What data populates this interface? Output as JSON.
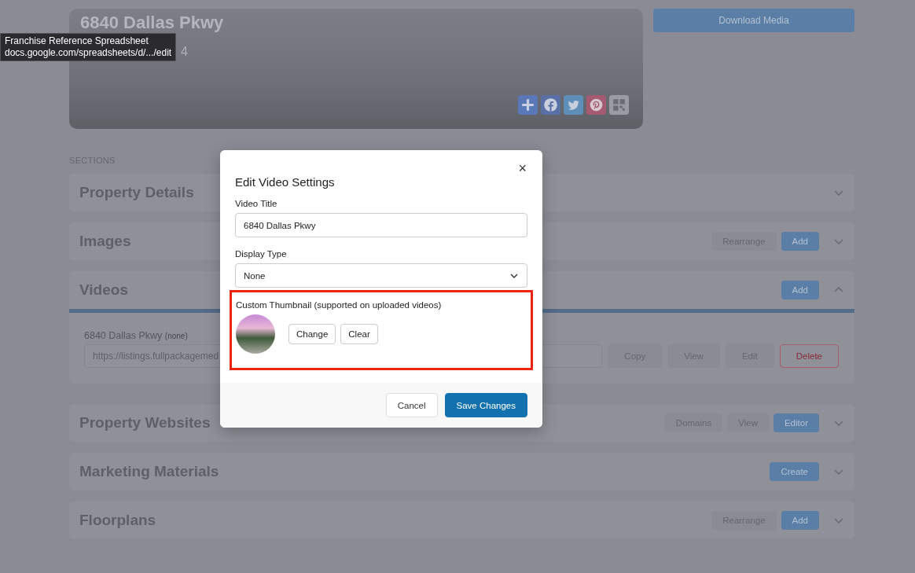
{
  "hero": {
    "title": "6840 Dallas Pkwy",
    "subtitle": "4",
    "share_icons": [
      {
        "kind": "plus"
      },
      {
        "kind": "facebook"
      },
      {
        "kind": "twitter"
      },
      {
        "kind": "pinterest"
      },
      {
        "kind": "qr"
      }
    ]
  },
  "tooltip": {
    "title": "Franchise Reference Spreadsheet",
    "url": "docs.google.com/spreadsheets/d/.../edit"
  },
  "download_button": "Download Media",
  "sections_label": "SECTIONS",
  "sections": [
    {
      "title": "Property Details",
      "expanded": false
    },
    {
      "title": "Images",
      "expanded": false,
      "buttons": [
        {
          "label": "Rearrange",
          "kind": "secondary"
        },
        {
          "label": "Add",
          "kind": "primary"
        }
      ]
    },
    {
      "title": "Videos",
      "expanded": true,
      "buttons": [
        {
          "label": "Add",
          "kind": "primary"
        }
      ],
      "videos": [
        {
          "name": "6840 Dallas Pkwy",
          "type": "(none)",
          "url": "https://listings.fullpackagemed",
          "buttons": [
            {
              "label": "Copy",
              "kind": "secondary"
            },
            {
              "label": "View",
              "kind": "secondary"
            },
            {
              "label": "Edit",
              "kind": "secondary"
            },
            {
              "label": "Delete",
              "kind": "danger"
            }
          ]
        }
      ]
    },
    {
      "title": "Property Websites",
      "expanded": false,
      "buttons": [
        {
          "label": "Domains",
          "kind": "secondary"
        },
        {
          "label": "View",
          "kind": "secondary"
        },
        {
          "label": "Editor",
          "kind": "primary"
        }
      ]
    },
    {
      "title": "Marketing Materials",
      "expanded": false,
      "buttons": [
        {
          "label": "Create",
          "kind": "primary"
        }
      ]
    },
    {
      "title": "Floorplans",
      "expanded": false,
      "buttons": [
        {
          "label": "Rearrange",
          "kind": "secondary"
        },
        {
          "label": "Add",
          "kind": "primary"
        }
      ]
    }
  ],
  "modal": {
    "title": "Edit Video Settings",
    "close": "×",
    "title_label": "Video Title",
    "title_value": "6840 Dallas Pkwy",
    "display_label": "Display Type",
    "display_value": "None",
    "thumbnail_label": "Custom Thumbnail (supported on uploaded videos)",
    "highlighted": true,
    "thumbnail_buttons": [
      "Change",
      "Clear"
    ],
    "cancel": "Cancel",
    "save": "Save Changes"
  }
}
